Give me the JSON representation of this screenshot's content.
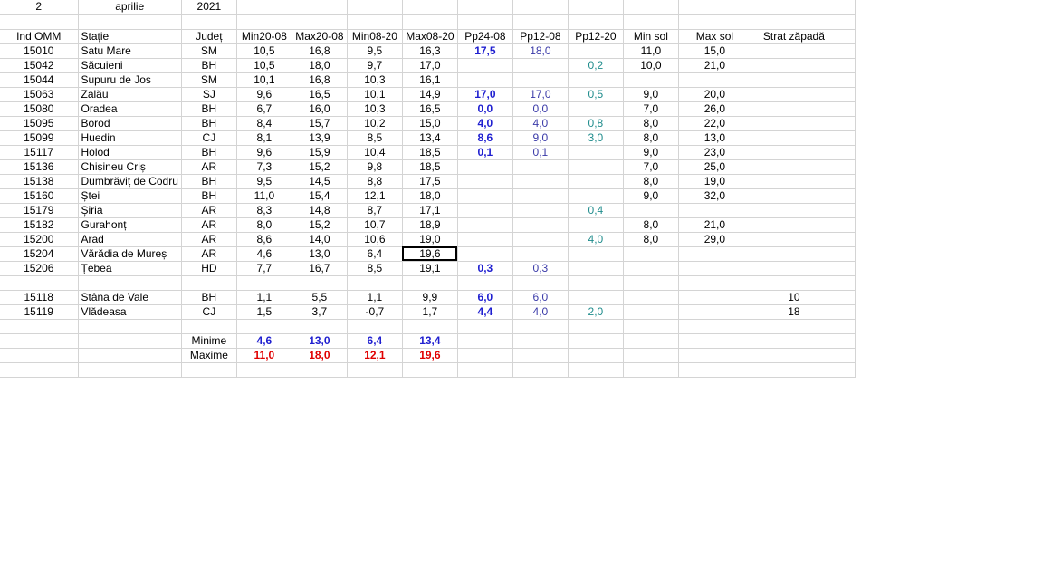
{
  "date": {
    "day": "2",
    "month": "aprilie",
    "year": "2021"
  },
  "headers": [
    "Ind OMM",
    "Stație",
    "Județ",
    "Min20-08",
    "Max20-08",
    "Min08-20",
    "Max08-20",
    "Pp24-08",
    "Pp12-08",
    "Pp12-20",
    "Min sol",
    "Max sol",
    "Strat zăpadă"
  ],
  "rows": [
    [
      "15010",
      "Satu Mare",
      "SM",
      "10,5",
      "16,8",
      "9,5",
      "16,3",
      "17,5",
      "18,0",
      "",
      "11,0",
      "15,0",
      ""
    ],
    [
      "15042",
      "Săcuieni",
      "BH",
      "10,5",
      "18,0",
      "9,7",
      "17,0",
      "",
      "",
      "0,2",
      "10,0",
      "21,0",
      ""
    ],
    [
      "15044",
      "Supuru de Jos",
      "SM",
      "10,1",
      "16,8",
      "10,3",
      "16,1",
      "",
      "",
      "",
      "",
      "",
      ""
    ],
    [
      "15063",
      "Zalău",
      "SJ",
      "9,6",
      "16,5",
      "10,1",
      "14,9",
      "17,0",
      "17,0",
      "0,5",
      "9,0",
      "20,0",
      ""
    ],
    [
      "15080",
      "Oradea",
      "BH",
      "6,7",
      "16,0",
      "10,3",
      "16,5",
      "0,0",
      "0,0",
      "",
      "7,0",
      "26,0",
      ""
    ],
    [
      "15095",
      "Borod",
      "BH",
      "8,4",
      "15,7",
      "10,2",
      "15,0",
      "4,0",
      "4,0",
      "0,8",
      "8,0",
      "22,0",
      ""
    ],
    [
      "15099",
      "Huedin",
      "CJ",
      "8,1",
      "13,9",
      "8,5",
      "13,4",
      "8,6",
      "9,0",
      "3,0",
      "8,0",
      "13,0",
      ""
    ],
    [
      "15117",
      "Holod",
      "BH",
      "9,6",
      "15,9",
      "10,4",
      "18,5",
      "0,1",
      "0,1",
      "",
      "9,0",
      "23,0",
      ""
    ],
    [
      "15136",
      "Chișineu   Criș",
      "AR",
      "7,3",
      "15,2",
      "9,8",
      "18,5",
      "",
      "",
      "",
      "7,0",
      "25,0",
      ""
    ],
    [
      "15138",
      "Dumbrăviț  de Codru",
      "BH",
      "9,5",
      "14,5",
      "8,8",
      "17,5",
      "",
      "",
      "",
      "8,0",
      "19,0",
      ""
    ],
    [
      "15160",
      "Ștei",
      "BH",
      "11,0",
      "15,4",
      "12,1",
      "18,0",
      "",
      "",
      "",
      "9,0",
      "32,0",
      ""
    ],
    [
      "15179",
      "Șiria",
      "AR",
      "8,3",
      "14,8",
      "8,7",
      "17,1",
      "",
      "",
      "0,4",
      "",
      "",
      ""
    ],
    [
      "15182",
      "Gurahonț",
      "AR",
      "8,0",
      "15,2",
      "10,7",
      "18,9",
      "",
      "",
      "",
      "8,0",
      "21,0",
      ""
    ],
    [
      "15200",
      "Arad",
      "AR",
      "8,6",
      "14,0",
      "10,6",
      "19,0",
      "",
      "",
      "4,0",
      "8,0",
      "29,0",
      ""
    ],
    [
      "15204",
      "Vărădia de Mureș",
      "AR",
      "4,6",
      "13,0",
      "6,4",
      "19,6",
      "",
      "",
      "",
      "",
      "",
      ""
    ],
    [
      "15206",
      "Țebea",
      "HD",
      "7,7",
      "16,7",
      "8,5",
      "19,1",
      "0,3",
      "0,3",
      "",
      "",
      "",
      ""
    ],
    [
      "",
      "",
      "",
      "",
      "",
      "",
      "",
      "",
      "",
      "",
      "",
      "",
      ""
    ],
    [
      "15118",
      "Stâna de Vale",
      "BH",
      "1,1",
      "5,5",
      "1,1",
      "9,9",
      "6,0",
      "6,0",
      "",
      "",
      "",
      "10"
    ],
    [
      "15119",
      "Vlădeasa",
      "CJ",
      "1,5",
      "3,7",
      "-0,7",
      "1,7",
      "4,4",
      "4,0",
      "2,0",
      "",
      "",
      "18"
    ]
  ],
  "summary": [
    {
      "label": "Minime",
      "values": [
        "4,6",
        "13,0",
        "6,4",
        "13,4"
      ],
      "color": "#1f1fd0"
    },
    {
      "label": "Maxime",
      "values": [
        "11,0",
        "18,0",
        "12,1",
        "19,6"
      ],
      "color": "#e00000"
    }
  ],
  "colors": {
    "blue": "#1f1fd0",
    "teal": "#1f8c8c",
    "red": "#e00000",
    "gridline": "#d4d4d4"
  },
  "selected_cell": {
    "row": 14,
    "col": 6
  }
}
